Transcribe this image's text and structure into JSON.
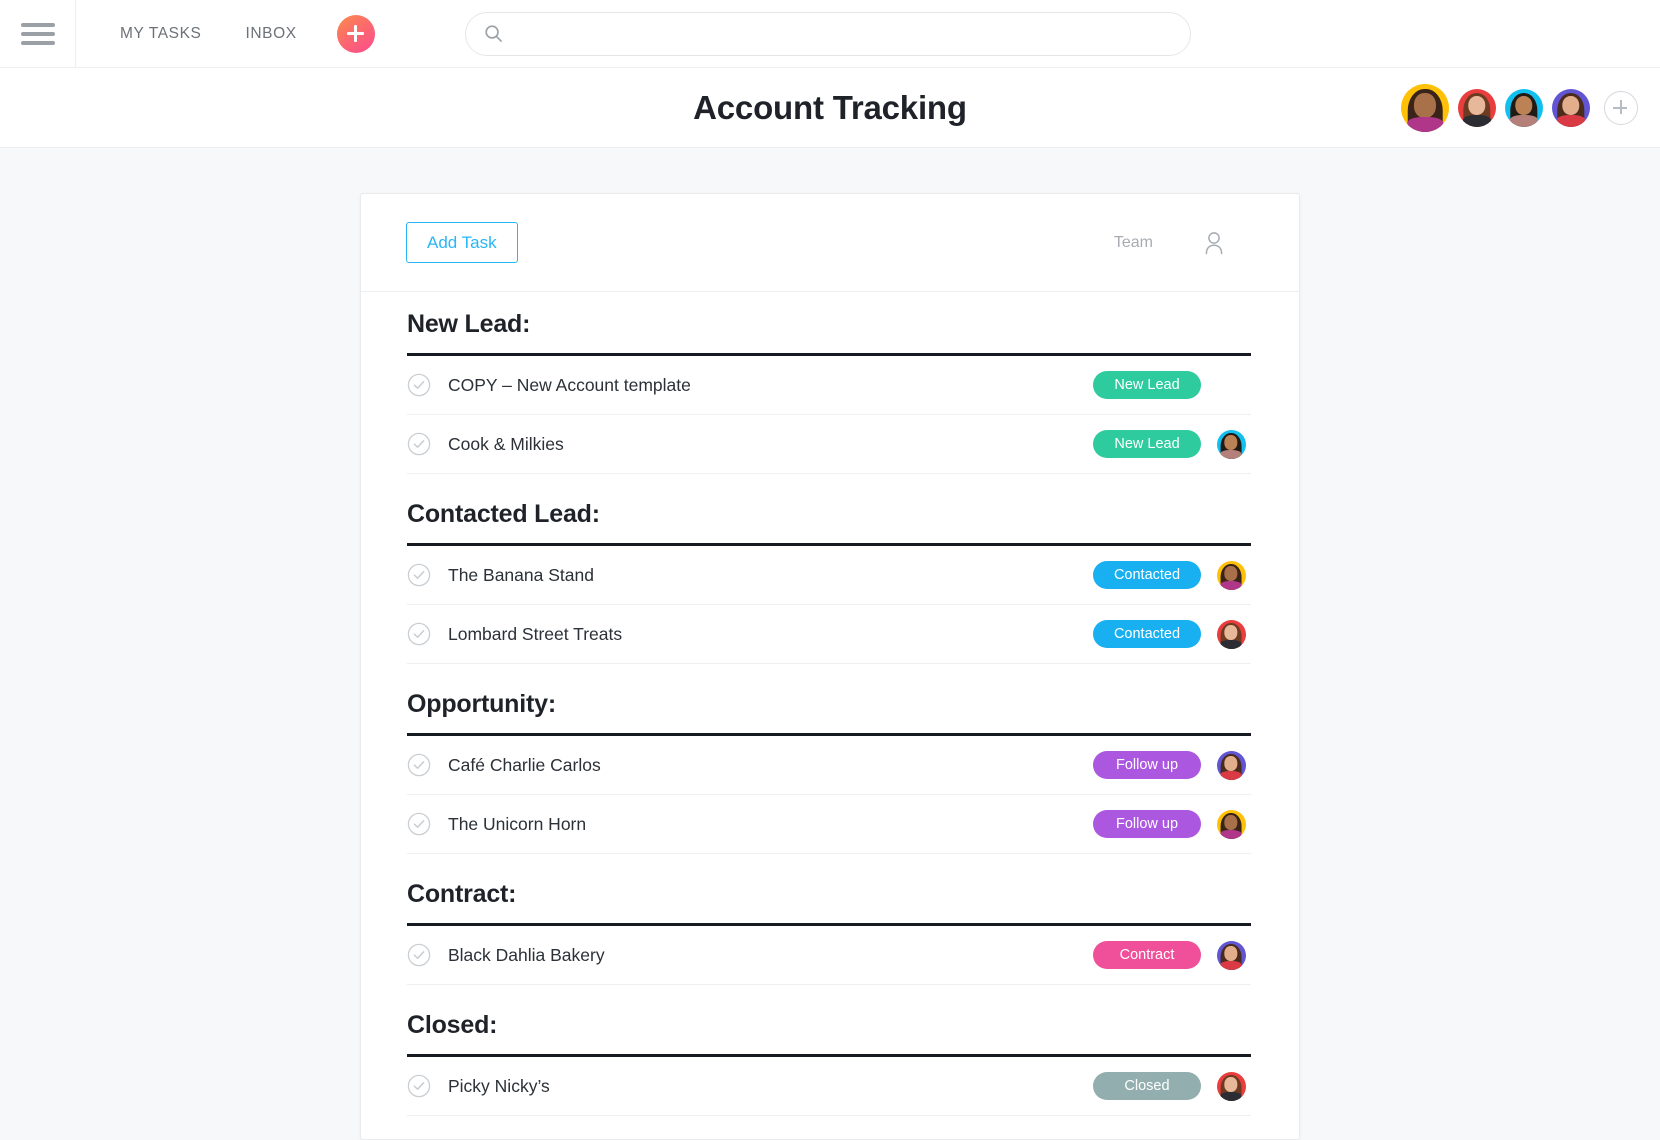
{
  "topbar": {
    "menu_icon": "hamburger-menu-icon",
    "links": [
      {
        "label": "MY TASKS"
      },
      {
        "label": "INBOX"
      }
    ],
    "add_button_icon": "plus-icon",
    "search": {
      "icon": "search-icon",
      "value": "",
      "placeholder": ""
    }
  },
  "header": {
    "title": "Account Tracking",
    "members": [
      {
        "name": "member-avatar-1",
        "ring": "#ffc107",
        "hair": "#3a2318",
        "skin": "#a9714a",
        "body": "#b0368a"
      },
      {
        "name": "member-avatar-2",
        "ring": "#ea3d3d",
        "hair": "#6d3b22",
        "skin": "#e8b89a",
        "body": "#2c2c33"
      },
      {
        "name": "member-avatar-3",
        "ring": "#11c0ef",
        "hair": "#221a14",
        "skin": "#bb8256",
        "body": "#b5807a"
      },
      {
        "name": "member-avatar-4",
        "ring": "#6155d4",
        "hair": "#4a2b1c",
        "skin": "#e2ae8c",
        "body": "#d93a44"
      }
    ],
    "add_member_icon": "plus-icon"
  },
  "card": {
    "add_task_label": "Add Task",
    "team_label": "Team",
    "person_icon": "person-icon"
  },
  "colors": {
    "new_lead": "#2ecb9e",
    "contacted": "#18b0f0",
    "follow_up": "#ab57e0",
    "contract": "#f0509a",
    "closed": "#93aeae",
    "accent_blue": "#29b6f6"
  },
  "sections": [
    {
      "title": "New Lead:",
      "tasks": [
        {
          "name": "COPY – New Account template",
          "tag": "New Lead",
          "tag_color": "#2ecb9e",
          "assignee": null
        },
        {
          "name": "Cook & Milkies",
          "tag": "New Lead",
          "tag_color": "#2ecb9e",
          "assignee": {
            "name": "assignee-avatar",
            "ring": "#11c0ef",
            "hair": "#221a14",
            "skin": "#bb8256",
            "body": "#b5807a"
          }
        }
      ]
    },
    {
      "title": "Contacted Lead:",
      "tasks": [
        {
          "name": "The Banana Stand",
          "tag": "Contacted",
          "tag_color": "#18b0f0",
          "assignee": {
            "name": "assignee-avatar",
            "ring": "#ffc107",
            "hair": "#3a2318",
            "skin": "#a9714a",
            "body": "#b0368a"
          }
        },
        {
          "name": "Lombard Street Treats",
          "tag": "Contacted",
          "tag_color": "#18b0f0",
          "assignee": {
            "name": "assignee-avatar",
            "ring": "#ea3d3d",
            "hair": "#6d3b22",
            "skin": "#e8b89a",
            "body": "#2c2c33"
          }
        }
      ]
    },
    {
      "title": "Opportunity:",
      "tasks": [
        {
          "name": "Café Charlie Carlos",
          "tag": "Follow up",
          "tag_color": "#ab57e0",
          "assignee": {
            "name": "assignee-avatar",
            "ring": "#6155d4",
            "hair": "#4a2b1c",
            "skin": "#e2ae8c",
            "body": "#d93a44"
          }
        },
        {
          "name": "The Unicorn Horn",
          "tag": "Follow up",
          "tag_color": "#ab57e0",
          "assignee": {
            "name": "assignee-avatar",
            "ring": "#ffc107",
            "hair": "#3a2318",
            "skin": "#a9714a",
            "body": "#b0368a"
          }
        }
      ]
    },
    {
      "title": "Contract:",
      "tasks": [
        {
          "name": "Black Dahlia Bakery",
          "tag": "Contract",
          "tag_color": "#f0509a",
          "assignee": {
            "name": "assignee-avatar",
            "ring": "#6155d4",
            "hair": "#4a2b1c",
            "skin": "#e2ae8c",
            "body": "#d93a44"
          }
        }
      ]
    },
    {
      "title": "Closed:",
      "tasks": [
        {
          "name": "Picky Nicky’s",
          "tag": "Closed",
          "tag_color": "#93aeae",
          "assignee": {
            "name": "assignee-avatar",
            "ring": "#ea3d3d",
            "hair": "#6d3b22",
            "skin": "#e8b89a",
            "body": "#2c2c33"
          }
        }
      ]
    }
  ]
}
